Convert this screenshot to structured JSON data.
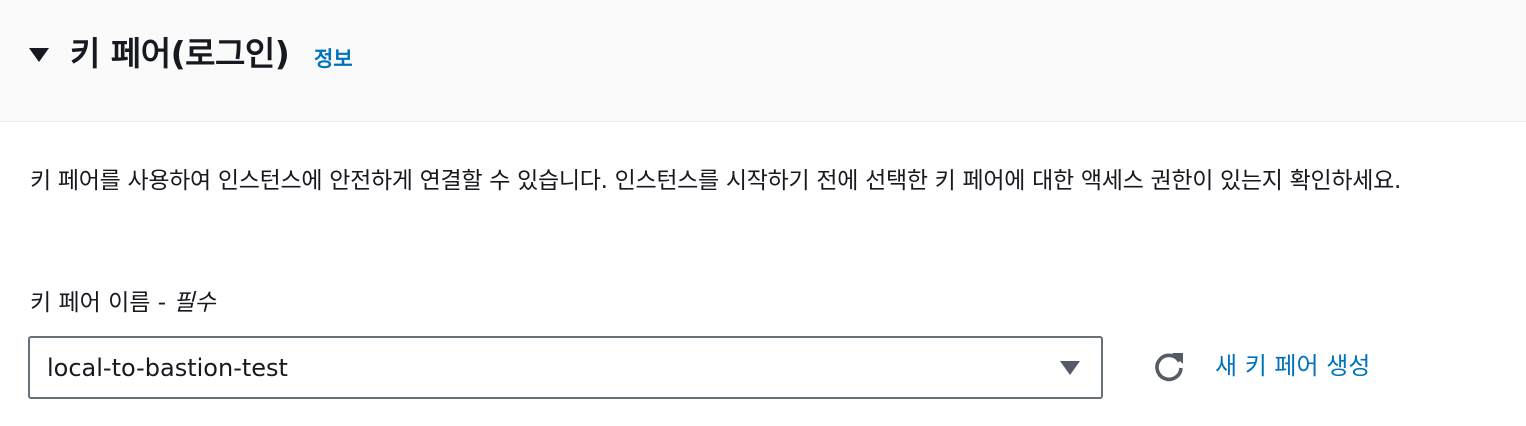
{
  "section": {
    "title": "키 페어(로그인)",
    "info_link": "정보",
    "expanded": true,
    "toggle_icon": "caret-down-icon",
    "description": "키 페어를 사용하여 인스턴스에 안전하게 연결할 수 있습니다. 인스턴스를 시작하기 전에 선택한 키 페어에 대한 액세스 권한이 있는지 확인하세요."
  },
  "key_pair_field": {
    "label": "키 페어 이름 - ",
    "required_label": "필수",
    "selected_value": "local-to-bastion-test",
    "dropdown_icon": "caret-down-icon"
  },
  "actions": {
    "refresh_icon": "refresh-icon",
    "create_link": "새 키 페어 생성"
  },
  "colors": {
    "header_bg": "#fafafa",
    "link": "#0073bb",
    "text": "#16191f",
    "border": "#687078",
    "icon": "#545b64"
  }
}
